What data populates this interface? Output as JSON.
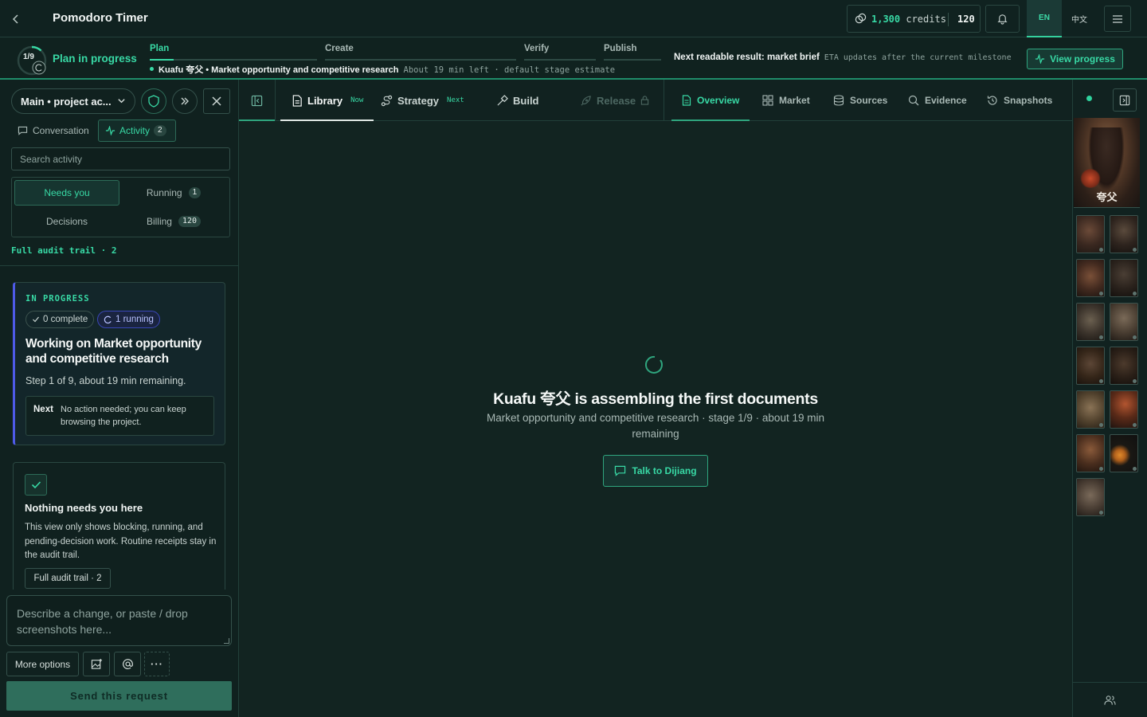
{
  "header": {
    "title": "Pomodoro Timer",
    "credits_amount": "1,300",
    "credits_unit": "credits",
    "credits_count": "120",
    "lang_en": "EN",
    "lang_zh": "中文"
  },
  "progress": {
    "ring_label": "1/9",
    "status": "Plan in progress",
    "stages": [
      {
        "label": "Plan",
        "active": true
      },
      {
        "label": "Create",
        "active": false
      },
      {
        "label": "Verify",
        "active": false
      },
      {
        "label": "Publish",
        "active": false
      }
    ],
    "current_task": "Kuafu 夸父 • Market opportunity and competitive research",
    "time_left": "About 19 min left · default stage estimate",
    "next_result": "Next readable result: market brief",
    "eta_note": "ETA updates after the current milestone",
    "view_button": "View progress"
  },
  "sidebar": {
    "branch": "Main • project ac...",
    "tabs": {
      "conversation": "Conversation",
      "activity": "Activity",
      "activity_count": "2"
    },
    "search_placeholder": "Search activity",
    "filters": {
      "needs_you": "Needs you",
      "running": "Running",
      "running_count": "1",
      "decisions": "Decisions",
      "billing": "Billing",
      "billing_count": "120"
    },
    "audit_link": "Full audit trail · 2",
    "in_progress": {
      "label": "IN PROGRESS",
      "complete": "0 complete",
      "running": "1 running",
      "heading": "Working on Market opportunity and competitive research",
      "step": "Step 1 of 9, about 19 min remaining.",
      "next_label": "Next",
      "next_text": "No action needed; you can keep browsing the project."
    },
    "nothing": {
      "heading": "Nothing needs you here",
      "description": "This view only shows blocking, running, and pending-decision work. Routine receipts stay in the audit trail.",
      "audit_button": "Full audit trail · 2"
    },
    "composer": {
      "placeholder": "Describe a change, or paste / drop screenshots here...",
      "more_options": "More options",
      "more_glyph": "···",
      "send": "Send this request"
    }
  },
  "tabs": {
    "left": [
      {
        "label": "Library",
        "sub": "Now"
      },
      {
        "label": "Strategy",
        "sub": "Next"
      },
      {
        "label": "Build",
        "sub": ""
      },
      {
        "label": "Release",
        "sub": ""
      }
    ],
    "right": [
      "Overview",
      "Market",
      "Sources",
      "Evidence",
      "Snapshots"
    ]
  },
  "main": {
    "title": "Kuafu 夸父 is assembling the first documents",
    "subtitle": "Market opportunity and competitive research · stage 1/9 · about 19 min remaining",
    "talk_button": "Talk to Dijiang"
  },
  "rail": {
    "hero_title": "夸父"
  },
  "colors": {
    "accent": "#38d9a5",
    "background": "#112220",
    "progress_card_border": "#4e5ae8"
  }
}
